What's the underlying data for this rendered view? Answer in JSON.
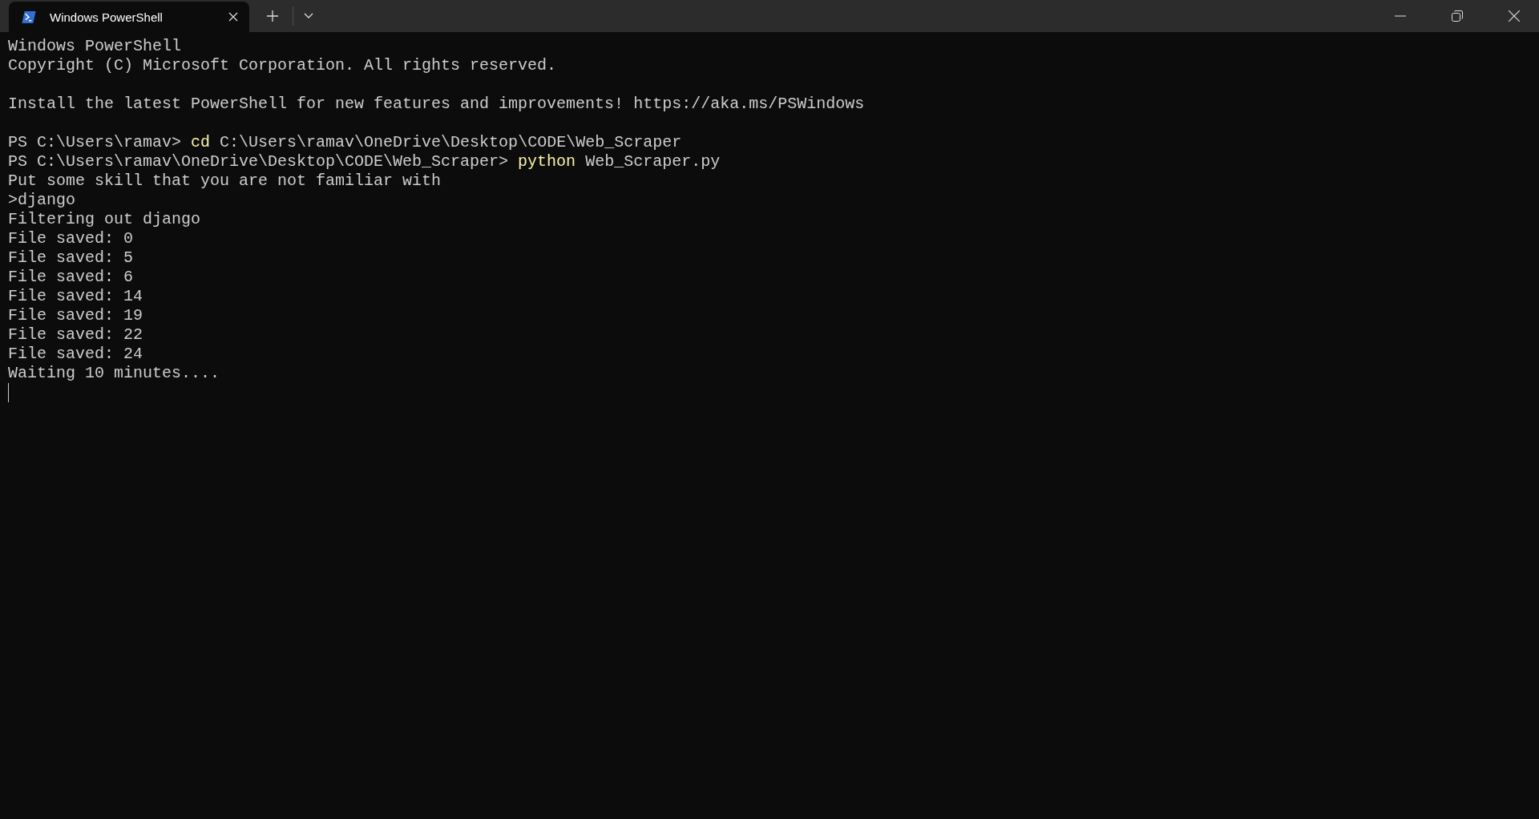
{
  "tabs": [
    {
      "title": "Windows PowerShell",
      "selected": true
    }
  ],
  "terminal": {
    "lines": [
      {
        "kind": "output",
        "text": "Windows PowerShell"
      },
      {
        "kind": "output",
        "text": "Copyright (C) Microsoft Corporation. All rights reserved."
      },
      {
        "kind": "blank"
      },
      {
        "kind": "output",
        "text": "Install the latest PowerShell for new features and improvements! https://aka.ms/PSWindows"
      },
      {
        "kind": "blank"
      },
      {
        "kind": "prompt",
        "prompt": "PS C:\\Users\\ramav>",
        "command": "cd",
        "args": "C:\\Users\\ramav\\OneDrive\\Desktop\\CODE\\Web_Scraper"
      },
      {
        "kind": "prompt",
        "prompt": "PS C:\\Users\\ramav\\OneDrive\\Desktop\\CODE\\Web_Scraper>",
        "command": "python",
        "args": "Web_Scraper.py"
      },
      {
        "kind": "output",
        "text": "Put some skill that you are not familiar with"
      },
      {
        "kind": "output",
        "text": ">django"
      },
      {
        "kind": "output",
        "text": "Filtering out django"
      },
      {
        "kind": "output",
        "text": "File saved: 0"
      },
      {
        "kind": "output",
        "text": "File saved: 5"
      },
      {
        "kind": "output",
        "text": "File saved: 6"
      },
      {
        "kind": "output",
        "text": "File saved: 14"
      },
      {
        "kind": "output",
        "text": "File saved: 19"
      },
      {
        "kind": "output",
        "text": "File saved: 22"
      },
      {
        "kind": "output",
        "text": "File saved: 24"
      },
      {
        "kind": "output",
        "text": "Waiting 10 minutes...."
      },
      {
        "kind": "cursor"
      }
    ]
  }
}
